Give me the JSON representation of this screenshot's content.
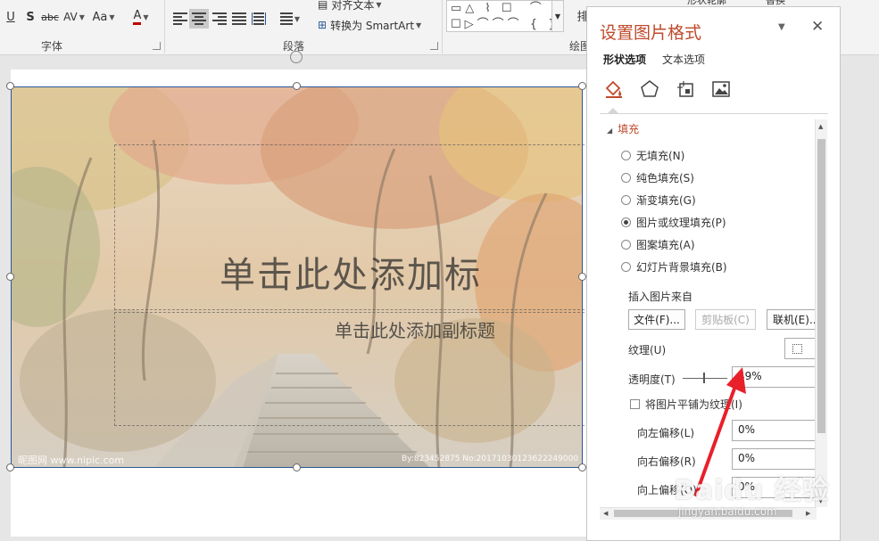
{
  "ribbon": {
    "font_group_label": "字体",
    "paragraph_group_label": "段落",
    "drawing_group_label": "绘图",
    "align_text": "对齐文本",
    "convert_smartart": "转换为 SmartArt",
    "shape_outline": "形状轮廓",
    "replace": "替换",
    "cut_label": "排",
    "font_buttons": {
      "underline": "U",
      "shadow": "S",
      "strike": "abc",
      "spacing": "AV",
      "case": "Aa",
      "color": "A"
    },
    "shapes_glyphs": "▭△ ⌇ ☐  ⌒ { }\n☐▷⌒⌒⌒ { }",
    "font_color": "#c00000"
  },
  "slide": {
    "title_placeholder": "单击此处添加标",
    "subtitle_placeholder": "单击此处添加副标题",
    "watermark_left": "昵图网 www.nipic.com",
    "watermark_right": "By:823452875 No:20171030123622249000"
  },
  "pane": {
    "title": "设置图片格式",
    "tabs": [
      {
        "label": "形状选项",
        "active": true
      },
      {
        "label": "文本选项",
        "active": false
      }
    ],
    "icons": [
      "fill-line-icon",
      "effects-icon",
      "size-properties-icon",
      "picture-icon"
    ],
    "section_fill": "填充",
    "fill_options": [
      {
        "label": "无填充(N)",
        "selected": false
      },
      {
        "label": "纯色填充(S)",
        "selected": false
      },
      {
        "label": "渐变填充(G)",
        "selected": false
      },
      {
        "label": "图片或纹理填充(P)",
        "selected": true
      },
      {
        "label": "图案填充(A)",
        "selected": false
      },
      {
        "label": "幻灯片背景填充(B)",
        "selected": false
      }
    ],
    "insert_from": "插入图片来自",
    "file_button": "文件(F)...",
    "clipboard_button": "剪贴板(C)",
    "online_button": "联机(E)...",
    "texture_label": "纹理(U)",
    "transparency_label": "透明度(T)",
    "transparency_value": "49%",
    "tile_checkbox": "将图片平铺为纹理(I)",
    "offset_left_label": "向左偏移(L)",
    "offset_left_value": "0%",
    "offset_right_label": "向右偏移(R)",
    "offset_right_value": "0%",
    "offset_top_label": "向上偏移(O)",
    "offset_top_value": "0%"
  },
  "overlay": {
    "baidu_logo": "Baidu 经验",
    "baidu_url": "jingyan.baidu.com",
    "arrow_color": "#e8202a",
    "accent_color": "#c04a2b"
  }
}
